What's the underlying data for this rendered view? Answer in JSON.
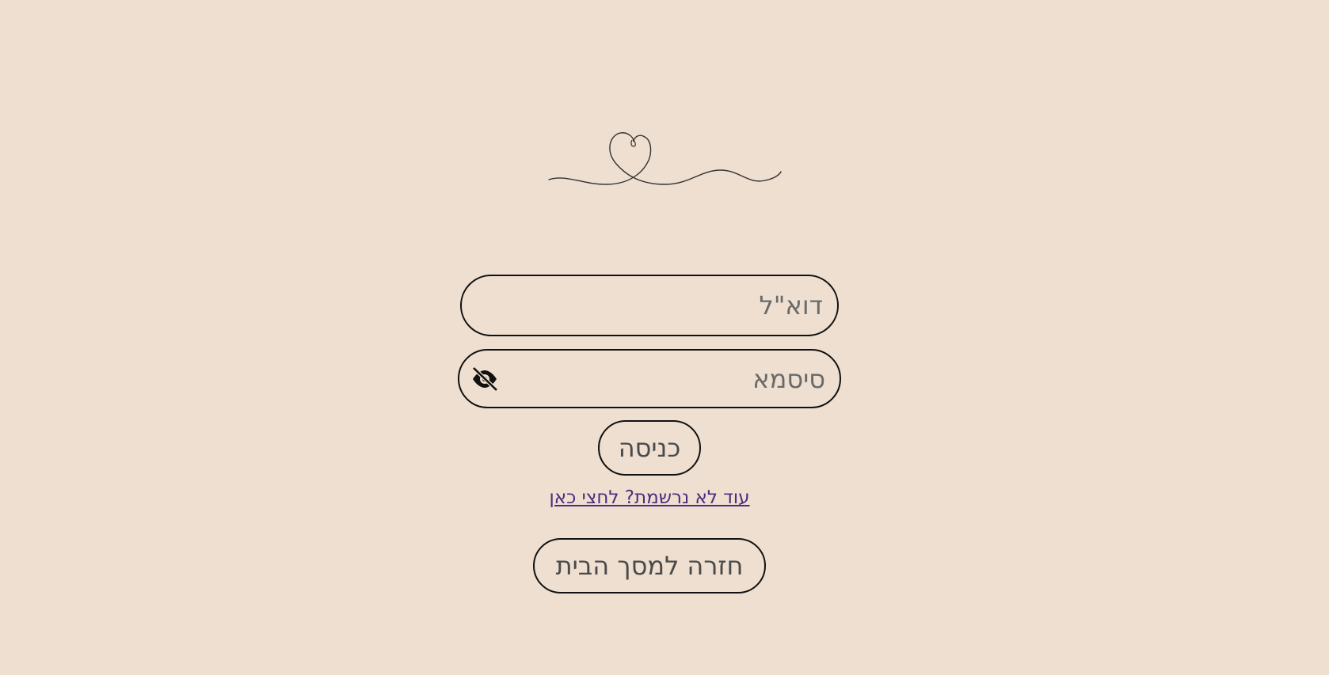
{
  "login_form": {
    "email_placeholder": "דוא\"ל",
    "email_value": "",
    "password_placeholder": "סיסמא",
    "password_value": "",
    "login_label": "כניסה",
    "register_link_text": "עוד לא נרשמת? לחצי כאן",
    "home_label": "חזרה למסך הבית"
  },
  "icons": {
    "logo": "heart-line-logo",
    "password_toggle": "eye-off-icon"
  },
  "colors": {
    "background": "#eedfd0",
    "border": "#111111",
    "link": "#4b2d7f",
    "text": "#4a4a4a"
  }
}
